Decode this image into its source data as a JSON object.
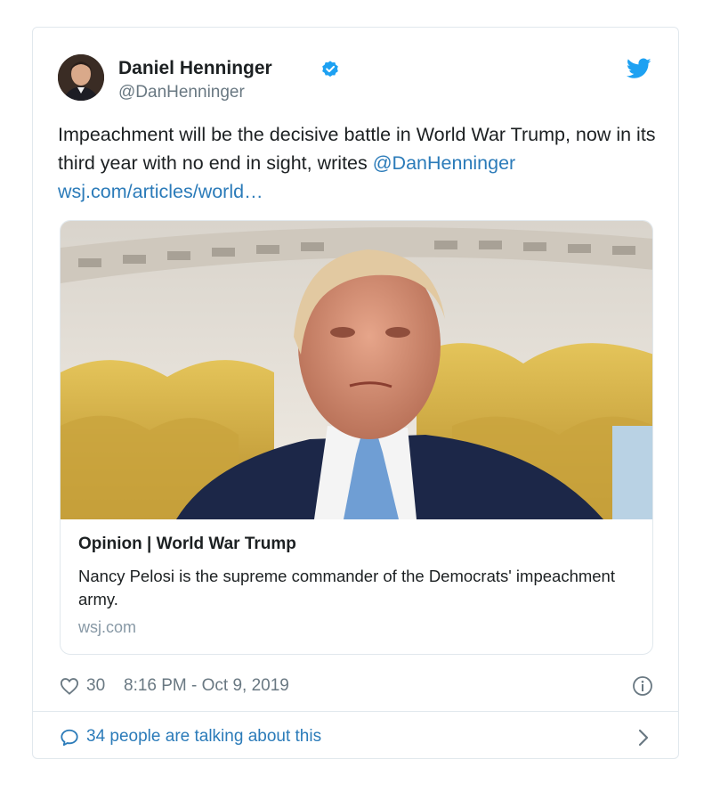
{
  "author": {
    "name": "Daniel Henninger",
    "handle": "@DanHenninger"
  },
  "tweet": {
    "text_part1": "Impeachment will be the decisive battle in World War Trump, now in its third year with no end in sight, writes ",
    "mention": "@DanHenninger",
    "link": "wsj.com/articles/world…"
  },
  "card": {
    "title": "Opinion | World War Trump",
    "description": "Nancy Pelosi is the supreme commander of the Democrats' impeachment army.",
    "domain": "wsj.com"
  },
  "meta": {
    "likes": "30",
    "timestamp": "8:16 PM - Oct 9, 2019"
  },
  "conversation": {
    "label": "34 people are talking about this"
  },
  "icons": {
    "verified": "verified-badge-icon",
    "bird": "twitter-bird-icon",
    "heart": "heart-icon",
    "info": "info-icon",
    "bubble": "speech-bubble-icon",
    "chevron": "chevron-right-icon"
  },
  "colors": {
    "link": "#2b7bb9",
    "text": "#1c2022",
    "muted": "#697882",
    "border": "#e1e8ed",
    "verified": "#1da1f2"
  }
}
